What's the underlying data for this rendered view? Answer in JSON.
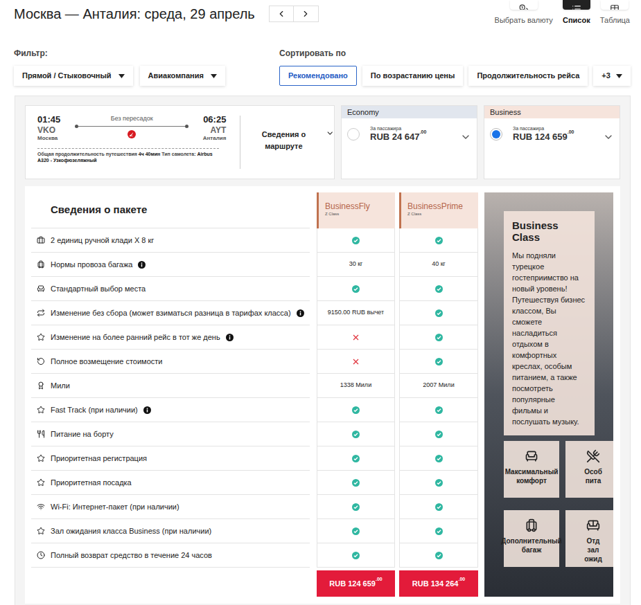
{
  "header": {
    "title": "Москва — Анталия: среда, 29 апрель",
    "views": [
      {
        "label": "Выбрать валюту",
        "selected": false
      },
      {
        "label": "Список",
        "selected": true
      },
      {
        "label": "Таблица",
        "selected": false
      }
    ]
  },
  "filter": {
    "label": "Фильтр:",
    "dropdowns": [
      "Прямой / Стыковочный",
      "Авиакомпания"
    ]
  },
  "sort": {
    "label": "Сортировать по",
    "options": [
      {
        "label": "Рекомендовано",
        "selected": true
      },
      {
        "label": "По возрастанию цены",
        "selected": false
      },
      {
        "label": "Продолжительность рейса",
        "selected": false
      }
    ],
    "more": "+3"
  },
  "flight": {
    "departure_time": "01:45",
    "departure_code": "VKO",
    "departure_city": "Москва",
    "stops": "Без пересадок",
    "arrival_time": "06:25",
    "arrival_code": "AYT",
    "arrival_city": "Анталия",
    "details_link": "Сведения о маршруте",
    "duration_label": "Общая продолжительность путешествия",
    "duration": "4ч 40мин",
    "aircraft_label": "Тип самолета:",
    "aircraft": "Airbus A320 - Узкофюзеляжный"
  },
  "cabins": [
    {
      "name": "Economy",
      "per_passenger": "За пассажира",
      "price": "RUB 24 647",
      "decimals": ".00",
      "selected": false,
      "color": "#e1e6ee"
    },
    {
      "name": "Business",
      "per_passenger": "За пассажира",
      "price": "RUB 124 659",
      "decimals": ".00",
      "selected": true,
      "color": "#f6e4dc"
    }
  ],
  "package": {
    "title": "Сведения о пакете",
    "fares": [
      {
        "name": "BusinessFly",
        "class": "Z Class",
        "price": "RUB 124 659",
        "decimals": ".00"
      },
      {
        "name": "BusinessPrime",
        "class": "Z Class",
        "price": "RUB 134 264",
        "decimals": ".00"
      }
    ],
    "features": [
      {
        "label": "2 единиц ручной клади X 8 кг",
        "info": false,
        "values": [
          {
            "kind": "check"
          },
          {
            "kind": "check"
          }
        ]
      },
      {
        "label": "Нормы провоза багажа",
        "info": true,
        "values": [
          {
            "kind": "text",
            "text": "30 кг"
          },
          {
            "kind": "text",
            "text": "40 кг"
          }
        ]
      },
      {
        "label": "Стандартный выбор места",
        "info": false,
        "values": [
          {
            "kind": "check"
          },
          {
            "kind": "check"
          }
        ]
      },
      {
        "label": "Изменение без сбора (может взиматься разница в тарифах класса)",
        "info": true,
        "values": [
          {
            "kind": "text",
            "text": "9150.00 RUB вычет"
          },
          {
            "kind": "check"
          }
        ]
      },
      {
        "label": "Изменение на более ранний рейс в тот же день",
        "info": true,
        "values": [
          {
            "kind": "cross"
          },
          {
            "kind": "check"
          }
        ]
      },
      {
        "label": "Полное возмещение стоимости",
        "info": false,
        "values": [
          {
            "kind": "cross"
          },
          {
            "kind": "check"
          }
        ]
      },
      {
        "label": "Мили",
        "info": false,
        "values": [
          {
            "kind": "text",
            "text": "1338 Мили"
          },
          {
            "kind": "text",
            "text": "2007 Мили"
          }
        ]
      },
      {
        "label": "Fast Track (при наличии)",
        "info": true,
        "values": [
          {
            "kind": "check"
          },
          {
            "kind": "check"
          }
        ]
      },
      {
        "label": "Питание на борту",
        "info": false,
        "values": [
          {
            "kind": "check"
          },
          {
            "kind": "check"
          }
        ]
      },
      {
        "label": "Приоритетная регистрация",
        "info": false,
        "values": [
          {
            "kind": "check"
          },
          {
            "kind": "check"
          }
        ]
      },
      {
        "label": "Приоритетная посадка",
        "info": false,
        "values": [
          {
            "kind": "check"
          },
          {
            "kind": "check"
          }
        ]
      },
      {
        "label": "Wi-Fi: Интернет-пакет (при наличии)",
        "info": false,
        "values": [
          {
            "kind": "check"
          },
          {
            "kind": "check"
          }
        ]
      },
      {
        "label": "Зал ожидания класса Business (при наличии)",
        "info": false,
        "values": [
          {
            "kind": "check"
          },
          {
            "kind": "check"
          }
        ]
      },
      {
        "label": "Полный возврат средство в течение 24 часов",
        "info": false,
        "values": [
          {
            "kind": "check"
          },
          {
            "kind": "check"
          }
        ]
      }
    ]
  },
  "promo": {
    "title": "Business Class",
    "text": "Мы подняли турецкое гостеприимство на новый уровень! Путешествуя бизнес классом, Вы сможете насладиться отдыхом в комфортных креслах, особым питанием, а также посмотреть популярные фильмы и послушать музыку.",
    "tiles": [
      {
        "lines": [
          "Максимальный",
          "комфорт"
        ]
      },
      {
        "lines": [
          "Особ",
          "пита"
        ]
      },
      {
        "lines": [
          "Дополнительный",
          "багаж"
        ]
      },
      {
        "lines": [
          "Отд",
          "зал",
          "ожид"
        ]
      }
    ]
  }
}
